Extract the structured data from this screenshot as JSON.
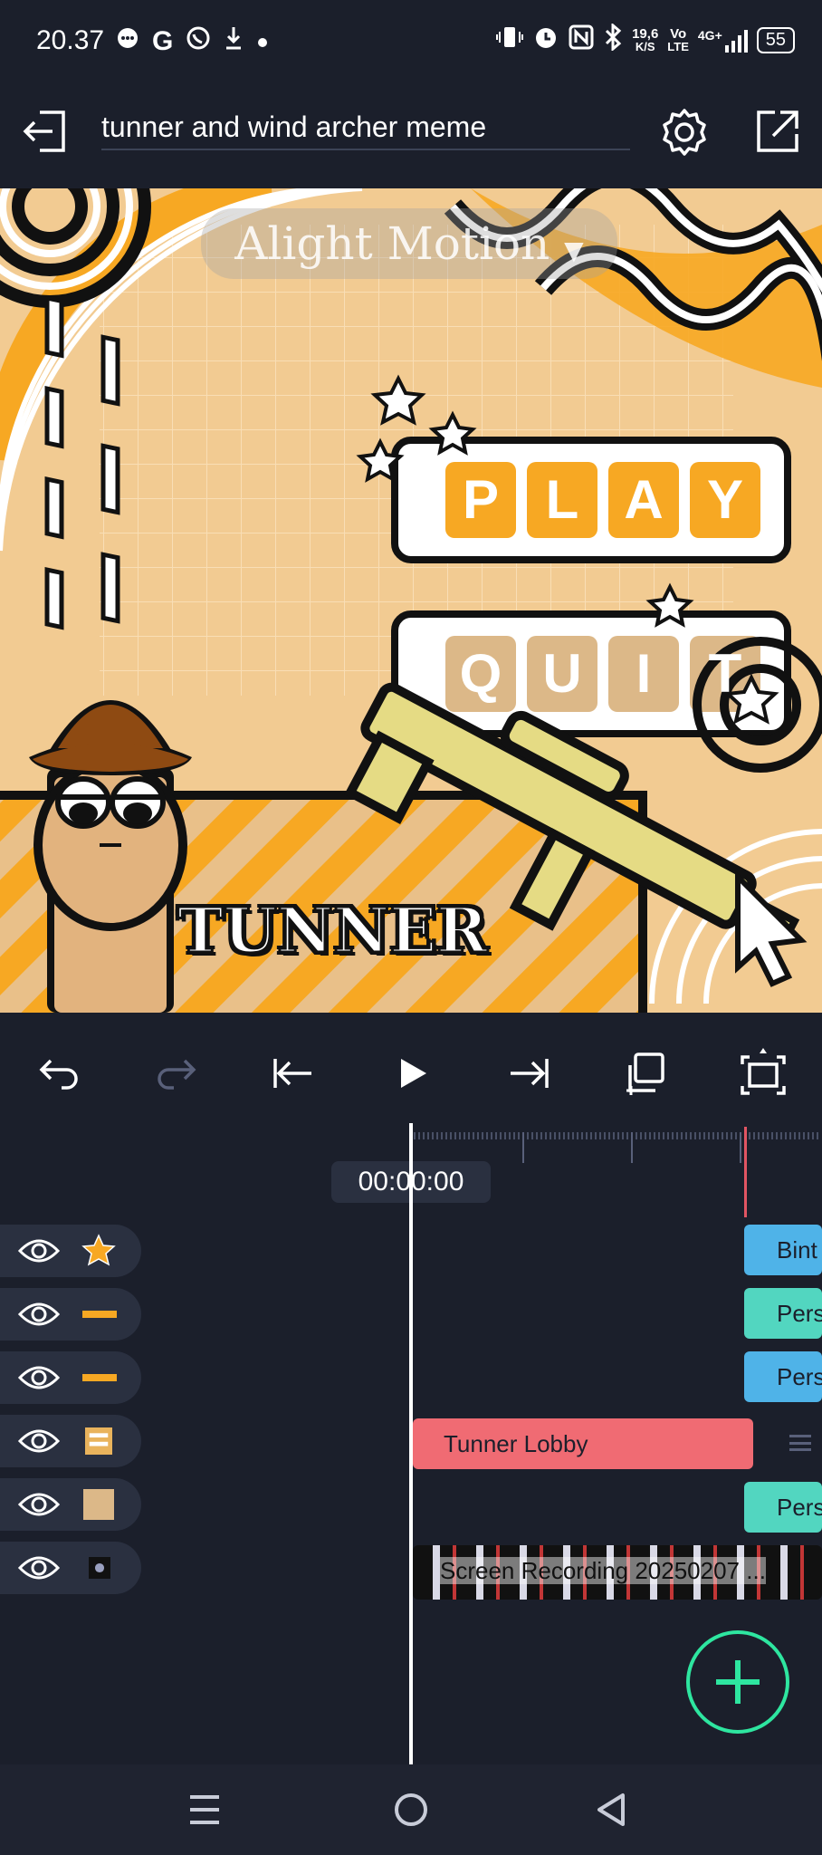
{
  "status_bar": {
    "time": "20.37",
    "icons": [
      "chat-icon",
      "google-icon",
      "whatsapp-icon",
      "download-icon",
      "dot-icon"
    ],
    "data_rate_value": "19,6",
    "data_rate_unit": "K/S",
    "volte_top": "Vo",
    "volte_bottom": "LTE",
    "network": "4G+",
    "battery": "55"
  },
  "header": {
    "project_title": "tunner and wind archer meme"
  },
  "canvas": {
    "watermark": "Alight Motion",
    "play_letters": [
      "P",
      "L",
      "A",
      "Y"
    ],
    "quit_letters": [
      "Q",
      "U",
      "I",
      "T"
    ],
    "character_name": "TUNNER"
  },
  "timeline": {
    "timecode": "00:00:00",
    "layers": [
      {
        "thumb": "star-sticker",
        "clip_label": "Bint",
        "clip_color": "#4fb3e8"
      },
      {
        "thumb": "orange-bar",
        "clip_label": "Pers",
        "clip_color": "#52d6c0"
      },
      {
        "thumb": "orange-bar",
        "clip_label": "Pers",
        "clip_color": "#4fb3e8"
      },
      {
        "thumb": "lobby-image",
        "clip_label": "Tunner Lobby",
        "clip_color": "#f06b73"
      },
      {
        "thumb": "beige-rect",
        "clip_label": "Pers",
        "clip_color": "#52d6c0"
      },
      {
        "thumb": "video-thumb",
        "clip_label": "Screen Recording 20250207 ...",
        "clip_color": "#111111"
      }
    ]
  },
  "colors": {
    "background": "#1b1f2b",
    "accent": "#2ee6a0",
    "canvas_orange": "#f7a823"
  }
}
